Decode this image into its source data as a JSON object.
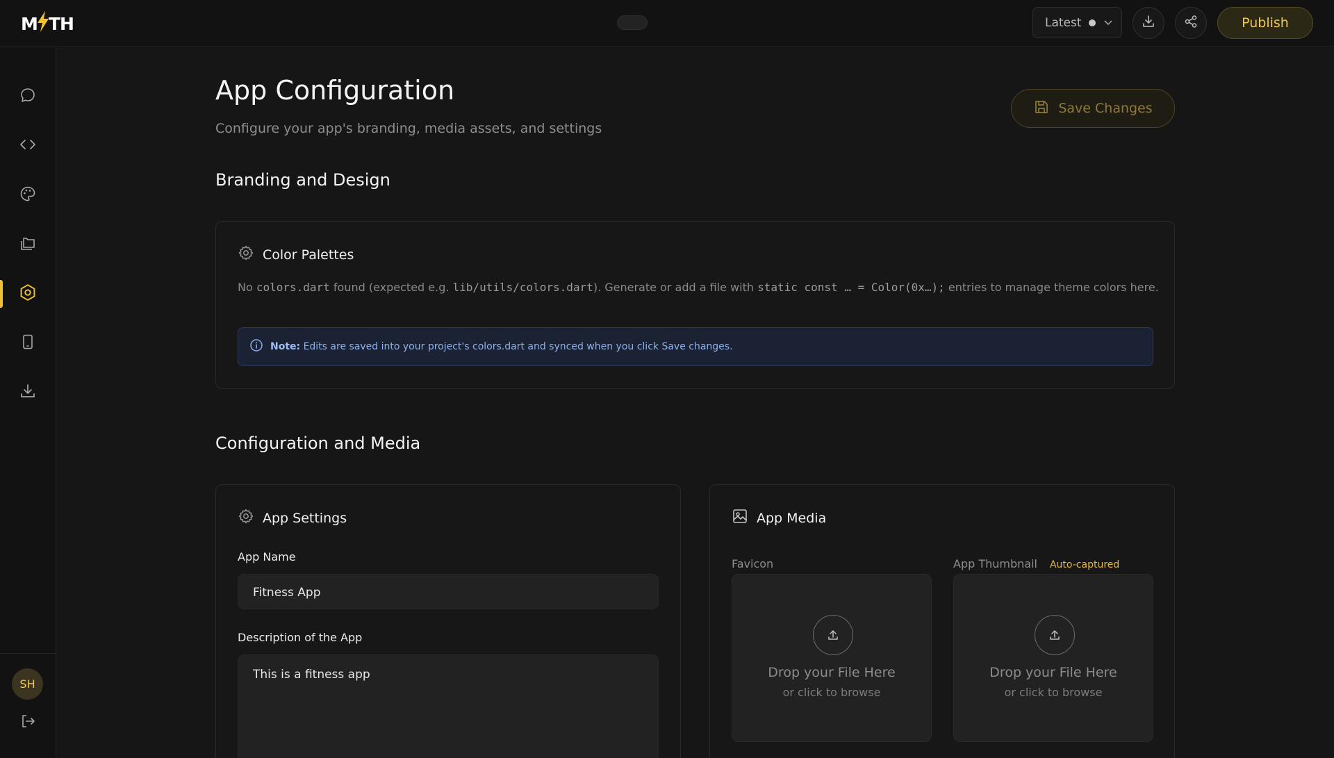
{
  "app": {
    "logo_text_left": "M",
    "logo_text_right": "TH",
    "version_label": "Latest",
    "publish_label": "Publish",
    "avatar_initials": "SH"
  },
  "colors": {
    "accent": "#f1c230",
    "background": "#161616",
    "note_text": "#8fb0ea"
  },
  "sidebar": {
    "items": [
      {
        "name": "chat-icon",
        "active": false
      },
      {
        "name": "code-icon",
        "active": false
      },
      {
        "name": "palette-icon",
        "active": false
      },
      {
        "name": "folders-icon",
        "active": false
      },
      {
        "name": "settings-hex-icon",
        "active": true
      },
      {
        "name": "mobile-device-icon",
        "active": false
      },
      {
        "name": "download-icon",
        "active": false
      }
    ]
  },
  "page": {
    "title": "App Configuration",
    "subtitle": "Configure your app's branding, media assets, and settings",
    "save_label": "Save Changes"
  },
  "branding": {
    "section_title": "Branding and Design",
    "card_title": "Color Palettes",
    "text_1": "No ",
    "code_1": "colors.dart",
    "text_2": " found (expected e.g. ",
    "code_2": "lib/utils/colors.dart",
    "text_3": "). Generate or add a file with ",
    "code_3": "static const … = Color(0x…);",
    "text_4": " entries to manage theme colors here.",
    "note_label": "Note:",
    "note_text": " Edits are saved into your project's colors.dart and synced when you click Save changes."
  },
  "config": {
    "section_title": "Configuration and Media",
    "settings_title": "App Settings",
    "app_name_label": "App Name",
    "app_name_value": "Fitness App",
    "description_label": "Description of the App",
    "description_value": "This is a fitness app",
    "media_title": "App Media",
    "favicon_label": "Favicon",
    "thumbnail_label": "App Thumbnail",
    "auto_captured": "Auto-captured",
    "drop_title": "Drop your File Here",
    "drop_sub": "or click to browse"
  }
}
